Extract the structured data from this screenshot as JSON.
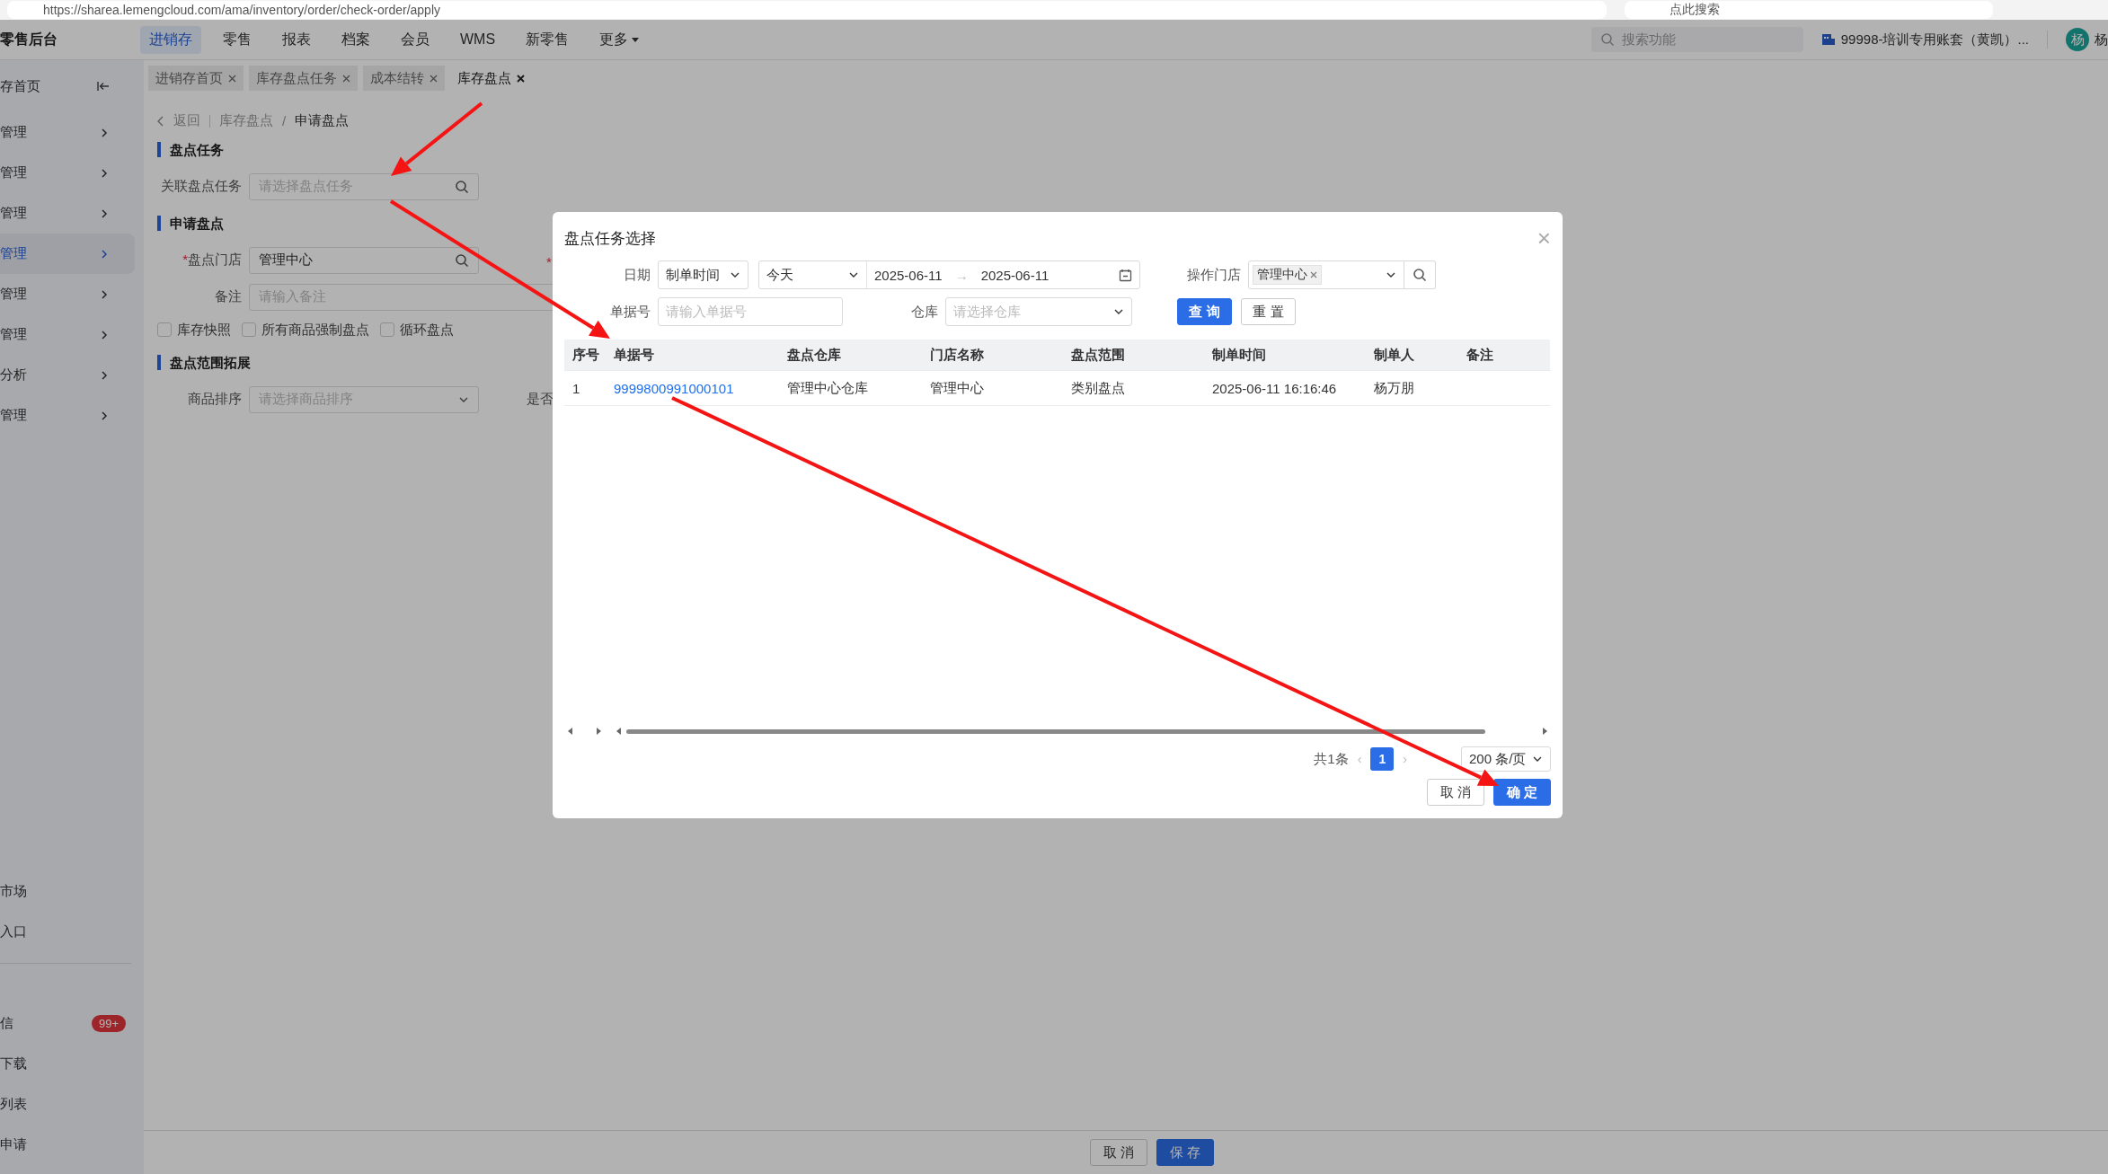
{
  "browser": {
    "url": "https://sharea.lemengcloud.com/ama/inventory/order/check-order/apply",
    "search_placeholder": "点此搜索"
  },
  "header": {
    "logo": "零售后台",
    "nav": [
      {
        "label": "进销存",
        "selected": true
      },
      {
        "label": "零售",
        "selected": false
      },
      {
        "label": "报表",
        "selected": false
      },
      {
        "label": "档案",
        "selected": false
      },
      {
        "label": "会员",
        "selected": false
      },
      {
        "label": "WMS",
        "selected": false
      },
      {
        "label": "新零售",
        "selected": false
      },
      {
        "label": "更多",
        "selected": false,
        "kind": "dropdown"
      }
    ],
    "search_placeholder": "搜索功能",
    "account": "99998-培训专用账套（黄凯）...",
    "avatar": "杨",
    "user": "杨"
  },
  "sidebar": {
    "home": "存首页",
    "menu": [
      {
        "label": "管理",
        "selected": false
      },
      {
        "label": "管理",
        "selected": false
      },
      {
        "label": "管理",
        "selected": false
      },
      {
        "label": "管理",
        "selected": true
      },
      {
        "label": "管理",
        "selected": false
      },
      {
        "label": "管理",
        "selected": false
      },
      {
        "label": "分析",
        "selected": false
      },
      {
        "label": "管理",
        "selected": false
      }
    ],
    "links": [
      {
        "label": "市场"
      },
      {
        "label": "入口"
      }
    ],
    "extras": [
      {
        "label": "信",
        "badge": "99+"
      },
      {
        "label": "下载"
      },
      {
        "label": "列表"
      },
      {
        "label": "申请"
      }
    ]
  },
  "tabs": [
    {
      "label": "进销存首页",
      "selected": false
    },
    {
      "label": "库存盘点任务",
      "selected": false
    },
    {
      "label": "成本结转",
      "selected": false
    },
    {
      "label": "库存盘点",
      "selected": true
    }
  ],
  "breadcrumb": {
    "back": "返回",
    "path": [
      "库存盘点",
      "申请盘点"
    ],
    "separator": "/"
  },
  "form": {
    "section_task": "盘点任务",
    "task_label": "关联盘点任务",
    "task_placeholder": "请选择盘点任务",
    "section_apply": "申请盘点",
    "store_label": "盘点门店",
    "store_value": "管理中心",
    "store_required_mark": "*",
    "note_label": "备注",
    "note_placeholder": "请输入备注",
    "right_required_mark": "*",
    "options": [
      {
        "label": "库存快照",
        "checked": false
      },
      {
        "label": "所有商品强制盘点",
        "checked": false
      },
      {
        "label": "循环盘点",
        "checked": false
      }
    ],
    "section_scope": "盘点范围拓展",
    "sort_label": "商品排序",
    "sort_placeholder": "请选择商品排序",
    "right_label": "是否"
  },
  "footer": {
    "cancel": "取 消",
    "save": "保 存"
  },
  "dialog": {
    "title": "盘点任务选择",
    "close": "×",
    "date_label": "日期",
    "date_type": "制单时间",
    "date_preset": "今天",
    "date_from": "2025-06-11",
    "date_to": "2025-06-11",
    "range_arrow": "→",
    "store_label": "操作门店",
    "store_tag": "管理中心",
    "doc_label": "单据号",
    "doc_placeholder": "请输入单据号",
    "warehouse_label": "仓库",
    "warehouse_placeholder": "请选择仓库",
    "query": "查 询",
    "reset": "重 置",
    "table": {
      "columns": [
        "序号",
        "单据号",
        "盘点仓库",
        "门店名称",
        "盘点范围",
        "制单时间",
        "制单人",
        "备注"
      ],
      "rows": [
        {
          "cells": [
            "1",
            "9999800991000101",
            "管理中心仓库",
            "管理中心",
            "类别盘点",
            "2025-06-11 16:16:46",
            "杨万朋"
          ]
        }
      ]
    },
    "pagination": {
      "total": "共1条",
      "prev": "‹",
      "pages": [
        {
          "label": "1",
          "selected": true
        }
      ],
      "next": "›",
      "page_size": "200 条/页"
    },
    "cancel": "取 消",
    "ok": "确 定"
  },
  "annotations": [
    {
      "kind": "arrow"
    },
    {
      "kind": "arrow"
    },
    {
      "kind": "arrow"
    }
  ]
}
